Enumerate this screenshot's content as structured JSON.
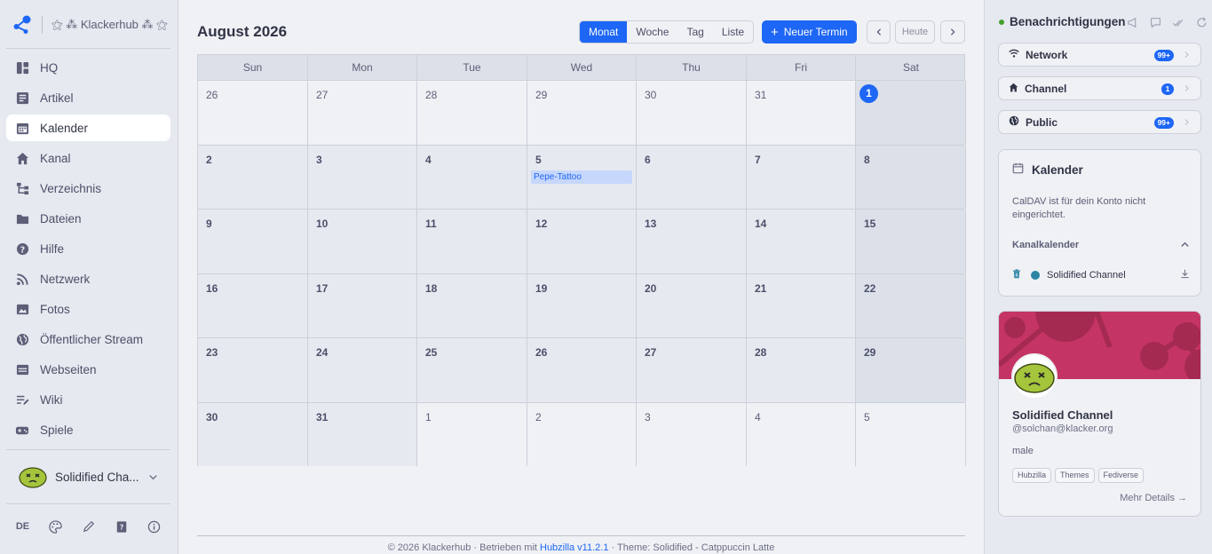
{
  "brand": {
    "name": "⚝ ⁂ Klackerhub ⁂ ⚝"
  },
  "nav": {
    "items": [
      {
        "label": "HQ",
        "icon": "dashboard-icon"
      },
      {
        "label": "Artikel",
        "icon": "article-icon"
      },
      {
        "label": "Kalender",
        "icon": "calendar-icon",
        "active": true
      },
      {
        "label": "Kanal",
        "icon": "home-icon"
      },
      {
        "label": "Verzeichnis",
        "icon": "sitemap-icon"
      },
      {
        "label": "Dateien",
        "icon": "folder-icon"
      },
      {
        "label": "Hilfe",
        "icon": "help-icon"
      },
      {
        "label": "Netzwerk",
        "icon": "rss-icon"
      },
      {
        "label": "Fotos",
        "icon": "image-icon"
      },
      {
        "label": "Öffentlicher Stream",
        "icon": "globe-icon"
      },
      {
        "label": "Webseiten",
        "icon": "webpage-icon"
      },
      {
        "label": "Wiki",
        "icon": "wiki-icon"
      },
      {
        "label": "Spiele",
        "icon": "gamepad-icon"
      }
    ]
  },
  "profile": {
    "name": "Solidified Cha..."
  },
  "tools": {
    "lang": "DE"
  },
  "calendar": {
    "title": "August 2026",
    "views": [
      "Monat",
      "Woche",
      "Tag",
      "Liste"
    ],
    "active_view": "Monat",
    "new_event": "Neuer Termin",
    "today": "Heute",
    "weekdays": [
      "Sun",
      "Mon",
      "Tue",
      "Wed",
      "Thu",
      "Fri",
      "Sat"
    ],
    "weeks": [
      [
        {
          "d": "26",
          "o": true
        },
        {
          "d": "27",
          "o": true
        },
        {
          "d": "28",
          "o": true
        },
        {
          "d": "29",
          "o": true
        },
        {
          "d": "30",
          "o": true
        },
        {
          "d": "31",
          "o": true
        },
        {
          "d": "1",
          "today": true
        }
      ],
      [
        {
          "d": "2"
        },
        {
          "d": "3"
        },
        {
          "d": "4"
        },
        {
          "d": "5",
          "event": "Pepe-Tattoo"
        },
        {
          "d": "6"
        },
        {
          "d": "7"
        },
        {
          "d": "8"
        }
      ],
      [
        {
          "d": "9"
        },
        {
          "d": "10"
        },
        {
          "d": "11"
        },
        {
          "d": "12"
        },
        {
          "d": "13"
        },
        {
          "d": "14"
        },
        {
          "d": "15"
        }
      ],
      [
        {
          "d": "16"
        },
        {
          "d": "17"
        },
        {
          "d": "18"
        },
        {
          "d": "19"
        },
        {
          "d": "20"
        },
        {
          "d": "21"
        },
        {
          "d": "22"
        }
      ],
      [
        {
          "d": "23"
        },
        {
          "d": "24"
        },
        {
          "d": "25"
        },
        {
          "d": "26"
        },
        {
          "d": "27"
        },
        {
          "d": "28"
        },
        {
          "d": "29"
        }
      ],
      [
        {
          "d": "30"
        },
        {
          "d": "31"
        },
        {
          "d": "1",
          "o": true
        },
        {
          "d": "2",
          "o": true
        },
        {
          "d": "3",
          "o": true
        },
        {
          "d": "4",
          "o": true
        },
        {
          "d": "5",
          "o": true
        }
      ]
    ]
  },
  "footer": {
    "prefix": "© 2026 Klackerhub · Betrieben mit ",
    "link": "Hubzilla v11.2.1",
    "suffix": " · Theme: Solidified - Catppuccin Latte"
  },
  "notifications": {
    "title": "Benachrichtigungen",
    "rows": [
      {
        "label": "Network",
        "badge": "99+",
        "icon": "wifi-icon"
      },
      {
        "label": "Channel",
        "badge": "1",
        "icon": "home-icon"
      },
      {
        "label": "Public",
        "badge": "99+",
        "icon": "globe-icon"
      }
    ]
  },
  "calendar_card": {
    "title": "Kalender",
    "text": "CalDAV ist für dein Konto nicht eingerichtet.",
    "subhead": "Kanalkalender",
    "channel": "Solidified Channel"
  },
  "profile_card": {
    "name": "Solidified Channel",
    "handle": "@solchan@klacker.org",
    "gender": "male",
    "tags": [
      "Hubzilla",
      "Themes",
      "Fediverse"
    ],
    "more": "Mehr Details →"
  },
  "colors": {
    "accent": "#1e66f5",
    "cover": "#c43565",
    "online": "#40a02b"
  }
}
